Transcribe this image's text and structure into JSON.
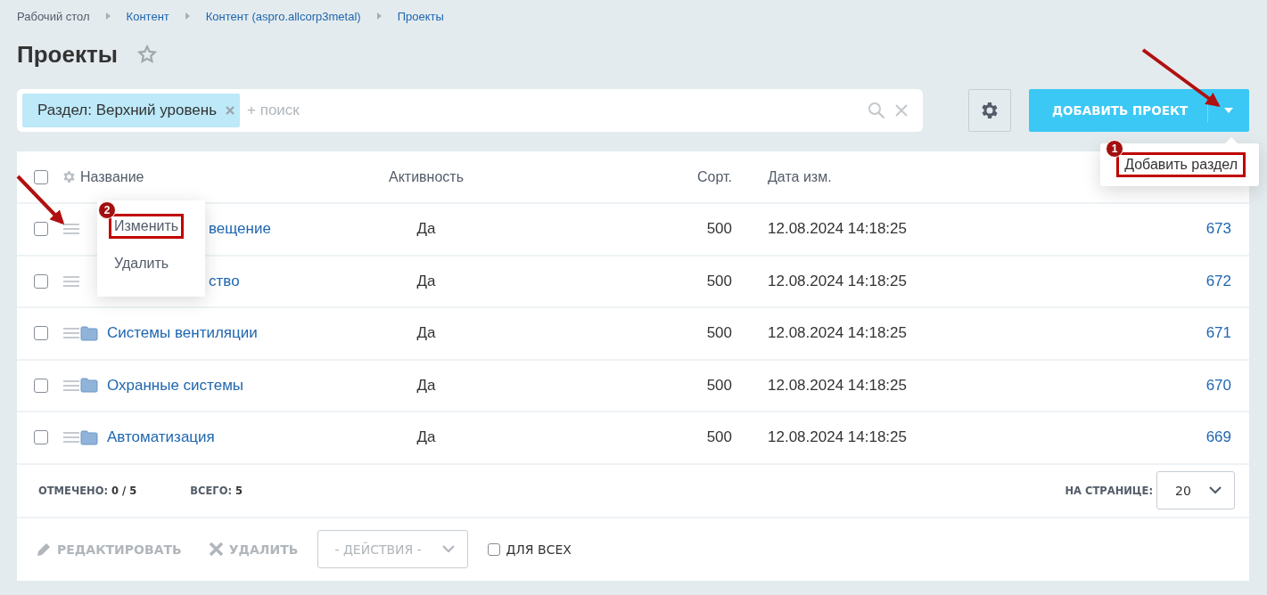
{
  "breadcrumbs": [
    "Рабочий стол",
    "Контент",
    "Контент (aspro.allcorp3metal)",
    "Проекты"
  ],
  "title": "Проекты",
  "favorite": false,
  "filter": {
    "tag": "Раздел: Верхний уровень",
    "placeholder": "+ поиск"
  },
  "add_button": {
    "label": "ДОБАВИТЬ ПРОЕКТ",
    "menu": [
      {
        "label": "Добавить раздел",
        "badge": "1"
      }
    ]
  },
  "table": {
    "header_checked": false,
    "columns": [
      "Название",
      "Активность",
      "Сорт.",
      "Дата изм."
    ],
    "context_menu": {
      "items": [
        {
          "label": "Изменить",
          "badge": "2"
        },
        {
          "label": "Удалить"
        }
      ]
    },
    "rows": [
      {
        "checked": false,
        "name": "вещение",
        "active": "Да",
        "sort": "500",
        "date": "12.08.2024 14:18:25",
        "id": "673"
      },
      {
        "checked": false,
        "name": "ство",
        "active": "Да",
        "sort": "500",
        "date": "12.08.2024 14:18:25",
        "id": "672"
      },
      {
        "checked": false,
        "name": "Системы вентиляции",
        "active": "Да",
        "sort": "500",
        "date": "12.08.2024 14:18:25",
        "id": "671"
      },
      {
        "checked": false,
        "name": "Охранные системы",
        "active": "Да",
        "sort": "500",
        "date": "12.08.2024 14:18:25",
        "id": "670"
      },
      {
        "checked": false,
        "name": "Автоматизация",
        "active": "Да",
        "sort": "500",
        "date": "12.08.2024 14:18:25",
        "id": "669"
      }
    ]
  },
  "summary": {
    "marked_label": "ОТМЕЧЕНО:",
    "marked": "0 / 5",
    "total_label": "ВСЕГО:",
    "total": "5",
    "per_page_label": "НА СТРАНИЦЕ:",
    "per_page": "20"
  },
  "actions": {
    "edit": {
      "label": "РЕДАКТИРОВАТЬ",
      "disabled": true
    },
    "delete": {
      "label": "УДАЛИТЬ",
      "disabled": true
    },
    "select": "- ДЕЙСТВИЯ -",
    "for_all": {
      "label": "ДЛЯ ВСЕХ",
      "checked": false
    }
  }
}
